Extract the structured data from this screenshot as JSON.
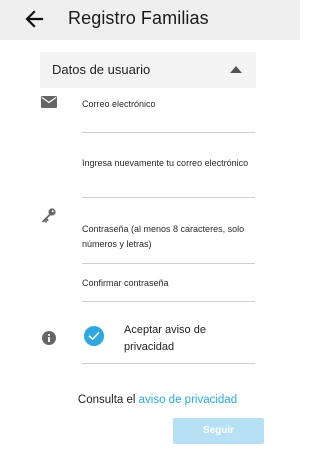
{
  "appbar": {
    "title": "Registro Familias",
    "back_icon": "arrow-left-icon"
  },
  "section": {
    "label": "Datos de usuario",
    "expanded": true,
    "caret_icon": "caret-up-icon"
  },
  "fields": {
    "email": {
      "placeholder": "Correo electrónico",
      "value": "",
      "icon": "envelope-icon"
    },
    "email_confirm": {
      "placeholder": "Ingresa nuevamente tu correo electrónico",
      "value": ""
    },
    "password": {
      "placeholder": "Contraseña (al menos 8 caracteres, solo números y letras)",
      "value": "",
      "icon": "key-icon"
    },
    "password_confirm": {
      "placeholder": "Confirmar contraseña",
      "value": ""
    }
  },
  "privacy_check": {
    "label": "Aceptar aviso de privacidad",
    "checked": true,
    "info_icon": "info-icon"
  },
  "privacy_note": {
    "prefix": "Consulta el",
    "link": "aviso de privacidad"
  },
  "submit": {
    "label": "Seguir",
    "enabled": false
  },
  "colors": {
    "accent": "#2ea8de",
    "disabled_button": "#b6e1f5",
    "appbar": "#efefef"
  }
}
